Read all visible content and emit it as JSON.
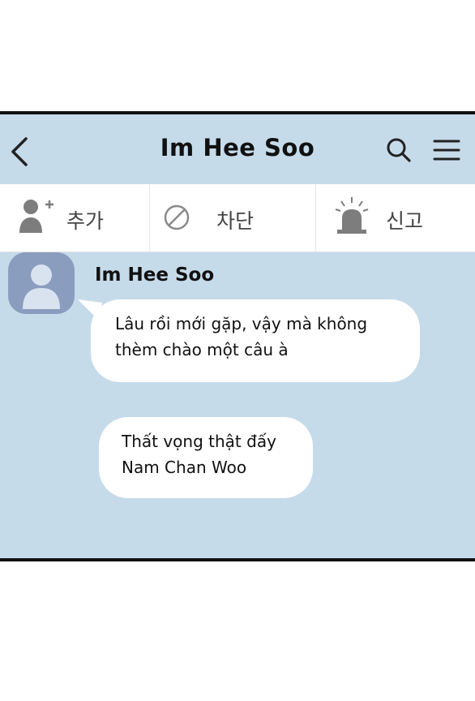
{
  "header": {
    "title": "Im Hee Soo",
    "back_icon": "chevron-left-icon",
    "search_icon": "search-icon",
    "menu_icon": "menu-icon"
  },
  "actions": {
    "add_label": "추가",
    "block_label": "차단",
    "report_label": "신고"
  },
  "chat": {
    "sender_name": "Im Hee Soo",
    "messages": [
      {
        "lines": [
          "Lâu rồi mới gặp, vậy mà không",
          "thèm chào một câu à"
        ]
      },
      {
        "lines": [
          "Thất vọng thật đấy",
          "Nam Chan Woo"
        ]
      }
    ]
  },
  "colors": {
    "chat_background": "#c6dbea",
    "avatar": "#8b9dbe",
    "bubble": "#ffffff"
  }
}
